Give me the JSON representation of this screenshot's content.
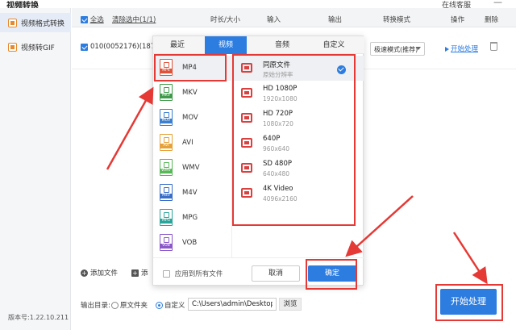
{
  "app": {
    "title": "视频转换",
    "service": "在线客服",
    "minimize": "—",
    "version": "版本号:1.22.10.211"
  },
  "sidebar": {
    "items": [
      {
        "label": "视频格式转换"
      },
      {
        "label": "视频转GIF"
      }
    ]
  },
  "table": {
    "select_all": "全选",
    "clear_failed": "清除选中(1/1)",
    "columns": [
      "时长/大小",
      "输入",
      "输出",
      "转换模式",
      "操作",
      "删除"
    ]
  },
  "file_row": {
    "name": "010(0052176)(18717",
    "mode": "极速模式(推荐)",
    "start": "开始处理"
  },
  "popup": {
    "tabs": [
      "最近",
      "视频",
      "音频",
      "自定义"
    ],
    "formats": [
      {
        "label": "MP4",
        "color": "#e0533a"
      },
      {
        "label": "MKV",
        "color": "#3f9b4a"
      },
      {
        "label": "MOV",
        "color": "#3a7fd0"
      },
      {
        "label": "AVI",
        "color": "#e6a13a"
      },
      {
        "label": "WMV",
        "color": "#57b857"
      },
      {
        "label": "M4V",
        "color": "#3a6fc9"
      },
      {
        "label": "MPG",
        "color": "#2aa59a"
      },
      {
        "label": "VOB",
        "color": "#8a58c9"
      }
    ],
    "presets": [
      {
        "name": "同原文件",
        "res": "原始分辨率"
      },
      {
        "name": "HD 1080P",
        "res": "1920x1080"
      },
      {
        "name": "HD 720P",
        "res": "1080x720"
      },
      {
        "name": "640P",
        "res": "960x640"
      },
      {
        "name": "SD 480P",
        "res": "640x480"
      },
      {
        "name": "4K Video",
        "res": "4096x2160"
      }
    ],
    "apply_all": "应用到所有文件",
    "cancel": "取消",
    "ok": "确定"
  },
  "bottom": {
    "add_file": "添加文件",
    "add_folder": "添",
    "output_label": "输出目录:",
    "radio_source": "原文件夹",
    "radio_custom": "自定义",
    "path": "C:\\Users\\admin\\Desktop",
    "browse": "浏览",
    "start": "开始处理"
  },
  "colors": {
    "accent": "#2d7de0",
    "annotation": "#e53935"
  }
}
